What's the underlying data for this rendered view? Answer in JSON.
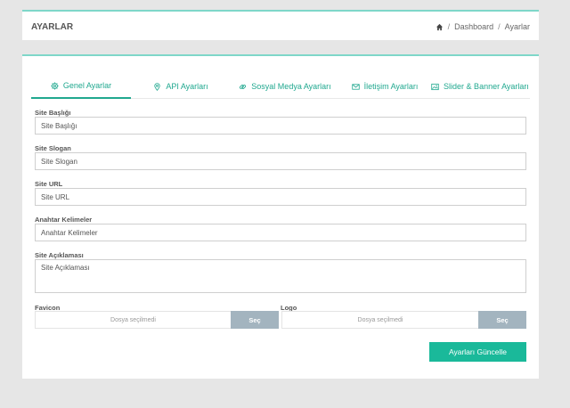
{
  "header": {
    "title": "AYARLAR",
    "breadcrumb": {
      "home_icon": "home-icon",
      "dashboard": "Dashboard",
      "current": "Ayarlar",
      "separator": "/"
    }
  },
  "tabs": [
    {
      "label": "Genel Ayarlar",
      "icon": "gear-icon",
      "active": true
    },
    {
      "label": "API Ayarları",
      "icon": "map-pin-icon",
      "active": false
    },
    {
      "label": "Sosyal Medya Ayarları",
      "icon": "link-icon",
      "active": false
    },
    {
      "label": "İletişim Ayarları",
      "icon": "envelope-icon",
      "active": false
    },
    {
      "label": "Slider & Banner Ayarları",
      "icon": "image-icon",
      "active": false
    }
  ],
  "form": {
    "site_title": {
      "label": "Site Başlığı",
      "value": "Site Başlığı"
    },
    "site_slogan": {
      "label": "Site Slogan",
      "value": "Site Slogan"
    },
    "site_url": {
      "label": "Site URL",
      "value": "Site URL"
    },
    "keywords": {
      "label": "Anahtar Kelimeler",
      "value": "Anahtar Kelimeler"
    },
    "description": {
      "label": "Site Açıklaması",
      "value": "Site Açıklaması"
    },
    "favicon": {
      "label": "Favicon",
      "file_text": "Dosya seçilmedi",
      "button": "Seç"
    },
    "logo": {
      "label": "Logo",
      "file_text": "Dosya seçilmedi",
      "button": "Seç"
    },
    "submit": "Ayarları Güncelle"
  },
  "colors": {
    "accent": "#1ab99a",
    "tab_text": "#20a88f",
    "top_border": "#7fd7c9",
    "file_button": "#a3b4bf"
  }
}
